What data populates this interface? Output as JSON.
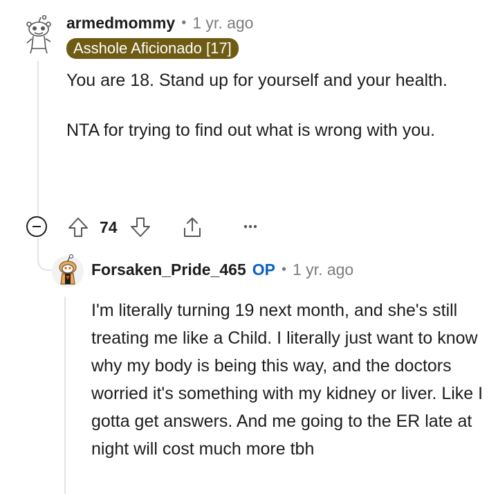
{
  "comments": [
    {
      "username": "armedmommy",
      "separator": "•",
      "time": "1 yr. ago",
      "flair": "Asshole Aficionado [17]",
      "paragraphs": [
        "You are 18. Stand up for yourself and your health.",
        "NTA for trying to find out what is wrong with you."
      ],
      "votes": "74",
      "avatar_icon": "snoo-avatar-icon"
    },
    {
      "username": "Forsaken_Pride_465",
      "op_badge": "OP",
      "separator": "•",
      "time": "1 yr. ago",
      "body": "I'm literally turning 19 next month, and she's still treating me like a Child. I literally just want to know why my body is being this way, and the doctors worried it's something with my kidney or liver. Like I gotta get answers. And me going to the ER late at night will cost much more tbh",
      "avatar_icon": "snoo-avatar-icon"
    }
  ],
  "actions": {
    "icons": [
      "collapse-icon",
      "upvote-icon",
      "downvote-icon",
      "share-icon",
      "more-icon"
    ]
  }
}
